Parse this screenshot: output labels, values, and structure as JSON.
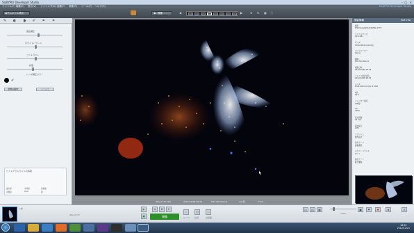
{
  "window": {
    "title": "SILKYPIX Developer Studio",
    "controls": [
      "–",
      "□",
      "✕"
    ]
  },
  "menu": {
    "items": [
      "ファイル(F)",
      "編集(E)",
      "表示(V)",
      "ファインダ(D)",
      "画像(P)",
      "現像(R)",
      "ツール(T)",
      "ヘルプ(H)"
    ],
    "brand": "SILKYPIX Developer Studio"
  },
  "toolbar": {
    "back_label": "サムネイル表示",
    "develop_label": "現像"
  },
  "left_panel": {
    "sliders": [
      {
        "label": "露出補正",
        "level": 0.55
      },
      {
        "label": "ホワイトバランス",
        "level": 0.5
      },
      {
        "label": "コントラスト",
        "level": 0.5
      },
      {
        "label": "彩度",
        "level": 0.45
      },
      {
        "label": "シャープネス",
        "level": 0.45
      }
    ],
    "color_label": "レンズ補正カラー",
    "reset_label": "調整初期化",
    "apply_label": "元に戻す",
    "histogram": {
      "title": "ヒストグラム/ライトの情報",
      "stats": [
        "最大値",
        "平均値",
        "画素数",
        "高輝度",
        "RAW",
        "値"
      ]
    }
  },
  "photo": {
    "caption": [
      "ウィンドウに合わせて表示中",
      "撮影日時",
      "カメラ",
      "露出"
    ],
    "status": [
      "IMG_0775.CR2",
      "2012/12/08 18:34",
      "EOS 5D Mark III",
      "1/8 秒",
      "F4.0"
    ]
  },
  "right_panel": {
    "title": "撮影情報",
    "title_en": "Exif Info",
    "items": [
      {
        "label": "撮影",
        "value": "E:\\Pictures\\201212\\IMG_0775"
      },
      {
        "label": "ファイルサイズ",
        "value": "25.4 MB"
      },
      {
        "label": "サイズ",
        "value": "5760×3840 (2210万)"
      },
      {
        "label": "カメラメーカー",
        "value": "Canon"
      },
      {
        "label": "機種",
        "value": "EOS 5D Mark III"
      },
      {
        "label": "撮影日時",
        "value": "2012/12/08 18:34"
      },
      {
        "label": "ファイル更新日時",
        "value": "2012/12/08 18:34"
      },
      {
        "label": "レンズ",
        "value": "EF24-105mm f/4L IS USM"
      },
      {
        "label": "F値",
        "value": "F4.0"
      },
      {
        "label": "シャッター速度",
        "value": "1/8 秒"
      },
      {
        "label": "ISO",
        "value": "3200"
      },
      {
        "label": "焦点距離",
        "value": "35 mm"
      },
      {
        "label": "露出補正",
        "value": "0 EV"
      },
      {
        "label": "フラッシュ",
        "value": "発光禁止"
      },
      {
        "label": "測光モード",
        "value": "評価測光"
      },
      {
        "label": "ホワイトバランス",
        "value": "オート"
      },
      {
        "label": "露出モード",
        "value": "絞り優先"
      }
    ]
  },
  "bottom": {
    "thumb_name": "IMG_0775",
    "film_label": "1枚",
    "save_label": "現像",
    "buttons": [
      "A",
      "B",
      "C"
    ],
    "tools": [
      "ルーペ",
      "比較",
      "全画面"
    ],
    "zoom_label": "100%"
  },
  "taskbar": {
    "time": "18:50",
    "date": "2012/12/21"
  }
}
